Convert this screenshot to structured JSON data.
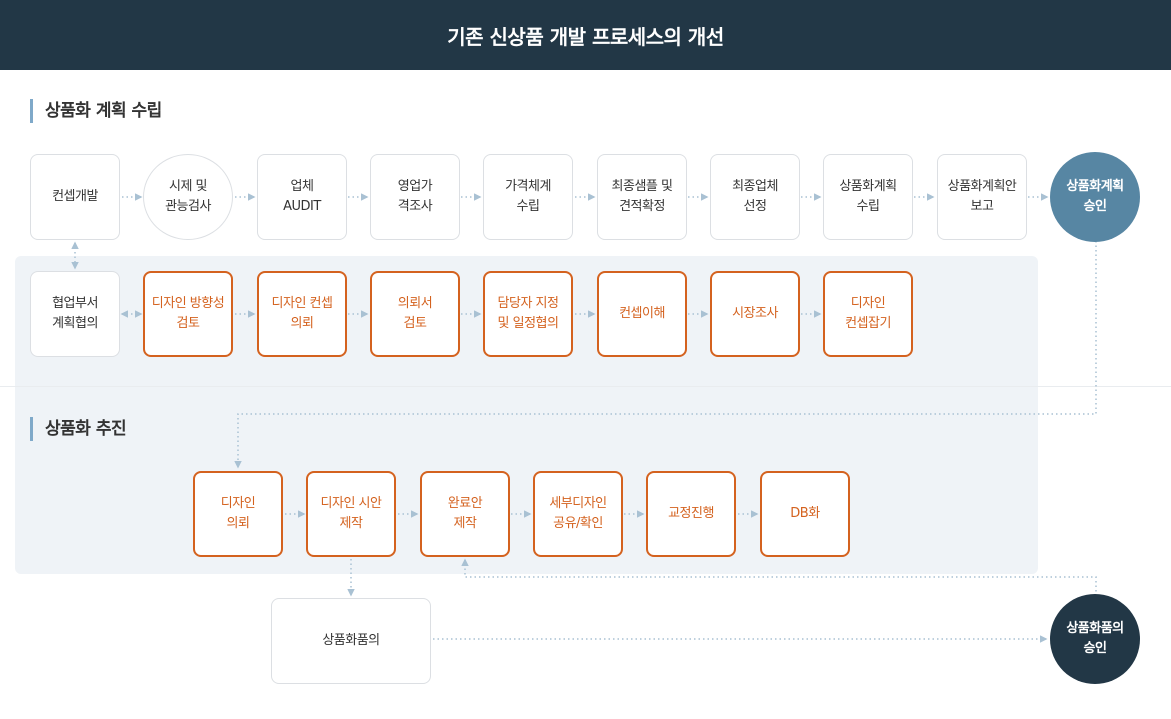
{
  "header": {
    "title": "기존 신상품 개발 프로세스의 개선"
  },
  "sections": {
    "planning": "상품화 계획 수립",
    "execution": "상품화 추진"
  },
  "planning_row": [
    "컨셉개발",
    "시제 및\n관능검사",
    "업체\nAUDIT",
    "영업가\n격조사",
    "가격체계\n수립",
    "최종샘플 및\n견적확정",
    "최종업체\n선정",
    "상품화계획\n수립",
    "상품화계획안\n보고",
    "상품화계획\n승인"
  ],
  "cooperation_row": [
    "협업부서\n계획협의",
    "디자인 방향성\n검토",
    "디자인 컨셉\n의뢰",
    "의뢰서\n검토",
    "담당자 지정\n및 일정협의",
    "컨셉이해",
    "시장조사",
    "디자인\n컨셉잡기"
  ],
  "execution_row": [
    "디자인\n의뢰",
    "디자인 시안\n제작",
    "완료안\n제작",
    "세부디자인\n공유/확인",
    "교정진행",
    "DB화"
  ],
  "consult": "상품화품의",
  "approval": "상품화품의\n승인",
  "colors": {
    "header_bg": "#223746",
    "accent_orange": "#d4621f",
    "approval_blue": "#5786a3",
    "approval_dark": "#223746",
    "panel_bg": "#eff3f7"
  }
}
